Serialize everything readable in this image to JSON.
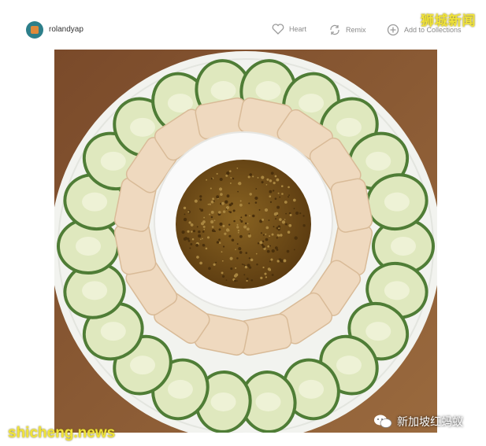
{
  "header": {
    "username": "rolandyap",
    "actions": [
      {
        "label": "Heart",
        "icon": "heart-icon"
      },
      {
        "label": "Remix",
        "icon": "remix-icon"
      },
      {
        "label": "Add to Collections",
        "icon": "add-collection-icon"
      }
    ]
  },
  "watermarks": {
    "top_right": "狮城新闻",
    "bottom_left": "shicheng.news",
    "bottom_right": "新加坡红蚂蚁"
  },
  "colors": {
    "table_wood": "#8a5a34",
    "plate": "#f2f3ef",
    "cucumber_skin": "#4f7d36",
    "cucumber_flesh": "#dfe8be",
    "chicken": "#efd9bf",
    "sauce": "#6a4a16",
    "watermark_yellow": "#f0e33a"
  }
}
